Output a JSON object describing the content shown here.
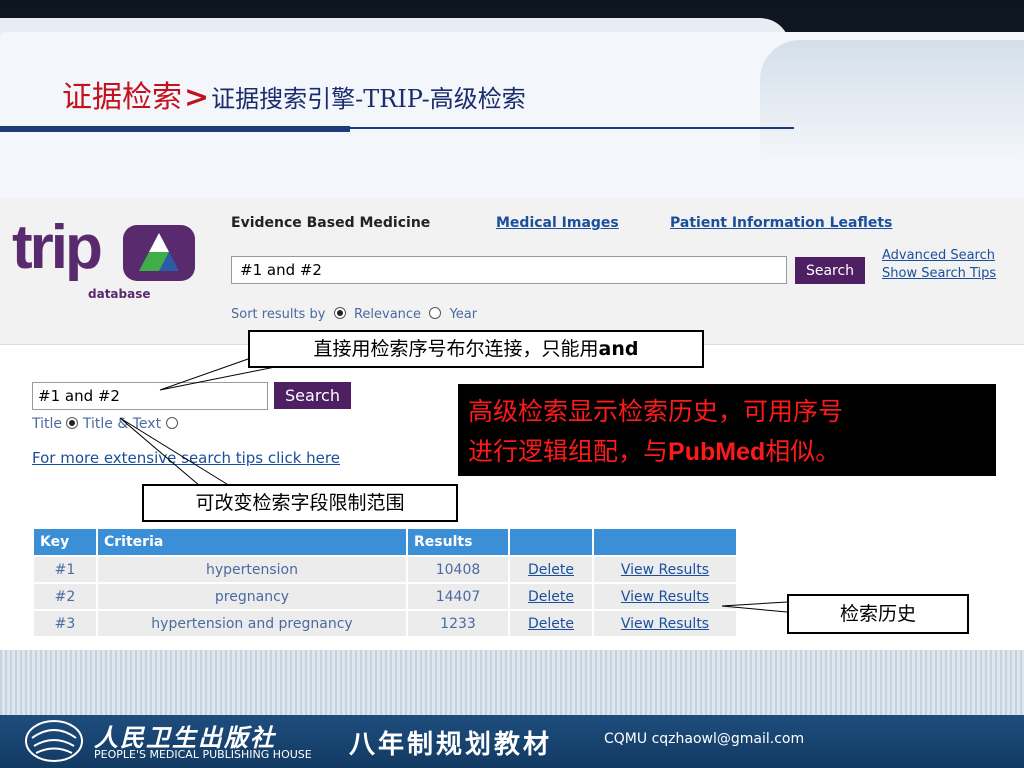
{
  "slide": {
    "title_main": "证据检索",
    "title_arrow": ">",
    "title_sub": "证据搜索引擎-TRIP-高级检索"
  },
  "trip": {
    "logo_text": "trip",
    "logo_sub": "database",
    "nav": {
      "ebm": "Evidence Based Medicine",
      "images": "Medical Images",
      "leaflets": "Patient Information Leaflets"
    },
    "search_value": "#1 and #2",
    "search_button": "Search",
    "advanced_search": "Advanced Search",
    "show_tips": "Show Search Tips",
    "sort_label": "Sort results by",
    "sort_relevance": "Relevance",
    "sort_year": "Year"
  },
  "advanced": {
    "input_value": "#1 and #2",
    "search_button": "Search",
    "field_title": "Title",
    "field_title_text": "Title & Text",
    "tips_link": "For more extensive search tips click here"
  },
  "history": {
    "headers": [
      "Key",
      "Criteria",
      "Results",
      "",
      ""
    ],
    "rows": [
      {
        "key": "#1",
        "criteria": "hypertension",
        "results": "10408",
        "delete": "Delete",
        "view": "View Results"
      },
      {
        "key": "#2",
        "criteria": "pregnancy",
        "results": "14407",
        "delete": "Delete",
        "view": "View Results"
      },
      {
        "key": "#3",
        "criteria": "hypertension and pregnancy",
        "results": "1233",
        "delete": "Delete",
        "view": "View Results"
      }
    ]
  },
  "annotations": {
    "and_note_prefix": "直接用检索序号布尔连接，只能用",
    "and_note_bold": "and",
    "field_note": "可改变检索字段限制范围",
    "history_note": "检索历史",
    "black_line1": "高级检索显示检索历史，可用序号",
    "black_line2_a": "进行逻辑组配，与",
    "black_line2_b": "PubMed",
    "black_line2_c": "相似。"
  },
  "footer": {
    "publisher_cn": "人民卫生出版社",
    "publisher_en": "PEOPLE'S MEDICAL PUBLISHING HOUSE",
    "series": "八年制规划教材",
    "credit": "CQMU cqzhaowl@gmail.com"
  },
  "colors": {
    "title_red": "#c3121c",
    "trip_purple": "#4e1f63",
    "table_header_blue": "#3a8fd6",
    "annotation_red": "#ff1a1a"
  }
}
